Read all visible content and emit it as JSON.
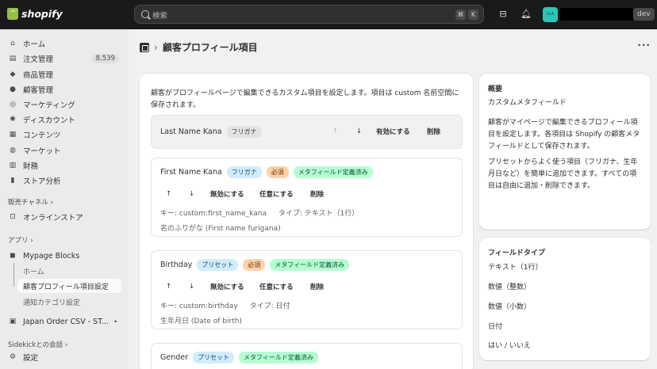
{
  "topbar": {
    "brand": "shopify",
    "search_placeholder": "検索",
    "shortcut_keys": [
      "⌘",
      "K"
    ],
    "avatar_initials": "I.LA",
    "env_badge": "dev"
  },
  "sidebar": {
    "items": [
      {
        "label": "ホーム",
        "icon": "home-icon"
      },
      {
        "label": "注文管理",
        "icon": "inbox-icon",
        "count": "8,539"
      },
      {
        "label": "商品管理",
        "icon": "tag-icon"
      },
      {
        "label": "顧客管理",
        "icon": "person-icon"
      },
      {
        "label": "マーケティング",
        "icon": "target-icon"
      },
      {
        "label": "ディスカウント",
        "icon": "discount-icon"
      },
      {
        "label": "コンテンツ",
        "icon": "content-icon"
      },
      {
        "label": "マーケット",
        "icon": "globe-icon"
      },
      {
        "label": "財務",
        "icon": "bank-icon"
      },
      {
        "label": "ストア分析",
        "icon": "chart-icon"
      }
    ],
    "sales_channels_label": "販売チャネル",
    "online_store": "オンラインストア",
    "apps_label": "アプリ",
    "app_name": "Mypage Blocks",
    "app_sub": [
      "ホーム",
      "顧客プロフィール項目設定",
      "通知カテゴリ設定"
    ],
    "app2": "Japan Order CSV - ST...",
    "sidekick": "Sidekickとの会話",
    "settings": "設定"
  },
  "page": {
    "title": "顧客プロフィール項目",
    "description": "顧客がプロフィールページで編集できるカスタム項目を設定します。項目は custom 名前空間に保存されます。",
    "items": [
      {
        "name": "Last Name Kana",
        "tags": [
          {
            "text": "フリガナ",
            "style": "gray"
          }
        ],
        "disabled": true,
        "actions": [
          "↑",
          "↓",
          "有効にする",
          "削除"
        ]
      },
      {
        "name": "First Name Kana",
        "tags": [
          {
            "text": "フリガナ",
            "style": "blue"
          },
          {
            "text": "必須",
            "style": "orange"
          },
          {
            "text": "メタフィールド定義済み",
            "style": "green"
          }
        ],
        "actions": [
          "↑",
          "↓",
          "無効にする",
          "任意にする",
          "削除"
        ],
        "key": "キー: custom:first_name_kana",
        "type": "タイプ: テキスト（1行）",
        "label": "名のふりがな (First name furigana)"
      },
      {
        "name": "Birthday",
        "tags": [
          {
            "text": "プリセット",
            "style": "blue"
          },
          {
            "text": "必須",
            "style": "orange"
          },
          {
            "text": "メタフィールド定義済み",
            "style": "green"
          }
        ],
        "actions": [
          "↑",
          "↓",
          "無効にする",
          "任意にする",
          "削除"
        ],
        "key": "キー: custom:birthday",
        "type": "タイプ: 日付",
        "label": "生年月日 (Date of birth)"
      },
      {
        "name": "Gender",
        "tags": [
          {
            "text": "プリセット",
            "style": "blue"
          },
          {
            "text": "メタフィールド定義済み",
            "style": "green"
          }
        ]
      }
    ]
  },
  "overview": {
    "title": "概要",
    "subtitle": "カスタムメタフィールド",
    "p1": "顧客がマイページで編集できるプロフィール項目を設定します。各項目は Shopify の顧客メタフィールドとして保存されます。",
    "p2": "プリセットからよく使う項目（フリガナ、生年月日など）を簡単に追加できます。すべての項目は自由に追加・削除できます。"
  },
  "field_types": {
    "title": "フィールドタイプ",
    "types": [
      "テキスト（1行）",
      "数値（整数）",
      "数値（小数）",
      "日付",
      "はい / いいえ"
    ]
  }
}
